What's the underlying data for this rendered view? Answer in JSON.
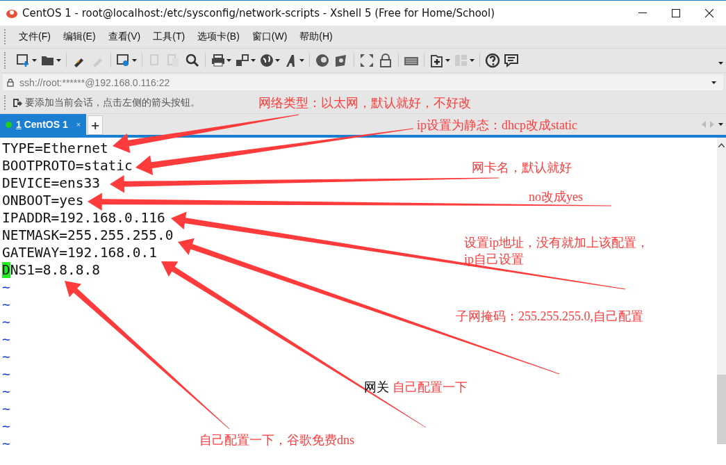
{
  "window": {
    "title": "CentOS 1 - root@localhost:/etc/sysconfig/network-scripts - Xshell 5 (Free for Home/School)"
  },
  "menu": [
    "文件(F)",
    "编辑(E)",
    "查看(V)",
    "工具(T)",
    "选项卡(B)",
    "窗口(W)",
    "帮助(H)"
  ],
  "address_bar": {
    "value": "ssh://root:******@192.168.0.116:22"
  },
  "hint_bar": {
    "text": "要添加当前会话，点击左侧的箭头按钮。"
  },
  "tabs": [
    {
      "number": "1",
      "label": "CentOS 1",
      "selected": true,
      "connected": true,
      "close": "×"
    }
  ],
  "new_tab": "+",
  "terminal": {
    "lines": [
      {
        "text": "TYPE=Ethernet",
        "cursor": false
      },
      {
        "text": "BOOTPROTO=static",
        "cursor": false
      },
      {
        "text": "DEVICE=ens33",
        "cursor": false
      },
      {
        "text": "ONBOOT=yes",
        "cursor": false
      },
      {
        "text": "IPADDR=192.168.0.116",
        "cursor": false
      },
      {
        "text": "NETMASK=255.255.255.0",
        "cursor": false
      },
      {
        "text": "GATEWAY=192.168.0.1",
        "cursor": false
      },
      {
        "text": "DNS1=8.8.8.8",
        "cursor": true
      }
    ],
    "empty_lines": [
      "~",
      "~",
      "~",
      "~",
      "~",
      "~",
      "~",
      "~",
      "~",
      "~"
    ]
  },
  "annotations": [
    {
      "segments": [
        {
          "text": "网络类型：以太网，默认就好，不好改",
          "color": "#ff3b3b"
        }
      ]
    },
    {
      "segments": [
        {
          "text": "ip设置为静态：dhcp改成static",
          "color": "#ff3b3b"
        }
      ]
    },
    {
      "segments": [
        {
          "text": "网卡名，默认就好",
          "color": "#ff3b3b"
        }
      ]
    },
    {
      "segments": [
        {
          "text": "no改成yes",
          "color": "#ff3b3b"
        }
      ]
    },
    {
      "segments": [
        {
          "text": "设置ip地址，没有就加上该配置，\nip自己设置",
          "color": "#ff3b3b"
        }
      ]
    },
    {
      "segments": [
        {
          "text": "子网掩码：255.255.255.0,自己配置",
          "color": "#ff3b3b"
        }
      ]
    },
    {
      "segments": [
        {
          "text": "网关",
          "color": "#000000"
        },
        {
          "text": " 自己配置一下",
          "color": "#ff3b3b"
        }
      ]
    },
    {
      "segments": [
        {
          "text": "自己配置一下，谷歌免费dns",
          "color": "#ff3b3b"
        }
      ]
    }
  ]
}
